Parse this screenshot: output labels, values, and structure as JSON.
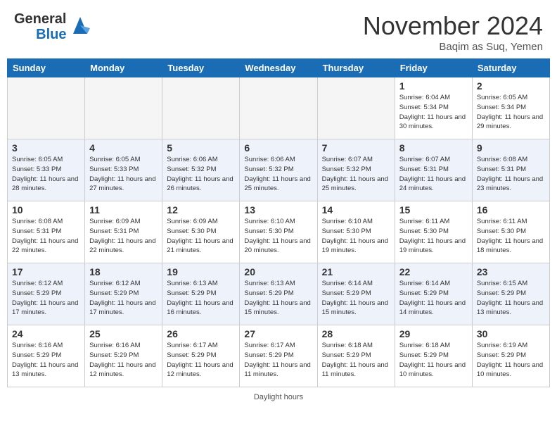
{
  "header": {
    "logo_general": "General",
    "logo_blue": "Blue",
    "month_title": "November 2024",
    "location": "Baqim as Suq, Yemen"
  },
  "days_of_week": [
    "Sunday",
    "Monday",
    "Tuesday",
    "Wednesday",
    "Thursday",
    "Friday",
    "Saturday"
  ],
  "weeks": [
    [
      {
        "day": "",
        "info": "",
        "empty": true
      },
      {
        "day": "",
        "info": "",
        "empty": true
      },
      {
        "day": "",
        "info": "",
        "empty": true
      },
      {
        "day": "",
        "info": "",
        "empty": true
      },
      {
        "day": "",
        "info": "",
        "empty": true
      },
      {
        "day": "1",
        "info": "Sunrise: 6:04 AM\nSunset: 5:34 PM\nDaylight: 11 hours and 30 minutes."
      },
      {
        "day": "2",
        "info": "Sunrise: 6:05 AM\nSunset: 5:34 PM\nDaylight: 11 hours and 29 minutes."
      }
    ],
    [
      {
        "day": "3",
        "info": "Sunrise: 6:05 AM\nSunset: 5:33 PM\nDaylight: 11 hours and 28 minutes."
      },
      {
        "day": "4",
        "info": "Sunrise: 6:05 AM\nSunset: 5:33 PM\nDaylight: 11 hours and 27 minutes."
      },
      {
        "day": "5",
        "info": "Sunrise: 6:06 AM\nSunset: 5:32 PM\nDaylight: 11 hours and 26 minutes."
      },
      {
        "day": "6",
        "info": "Sunrise: 6:06 AM\nSunset: 5:32 PM\nDaylight: 11 hours and 25 minutes."
      },
      {
        "day": "7",
        "info": "Sunrise: 6:07 AM\nSunset: 5:32 PM\nDaylight: 11 hours and 25 minutes."
      },
      {
        "day": "8",
        "info": "Sunrise: 6:07 AM\nSunset: 5:31 PM\nDaylight: 11 hours and 24 minutes."
      },
      {
        "day": "9",
        "info": "Sunrise: 6:08 AM\nSunset: 5:31 PM\nDaylight: 11 hours and 23 minutes."
      }
    ],
    [
      {
        "day": "10",
        "info": "Sunrise: 6:08 AM\nSunset: 5:31 PM\nDaylight: 11 hours and 22 minutes."
      },
      {
        "day": "11",
        "info": "Sunrise: 6:09 AM\nSunset: 5:31 PM\nDaylight: 11 hours and 22 minutes."
      },
      {
        "day": "12",
        "info": "Sunrise: 6:09 AM\nSunset: 5:30 PM\nDaylight: 11 hours and 21 minutes."
      },
      {
        "day": "13",
        "info": "Sunrise: 6:10 AM\nSunset: 5:30 PM\nDaylight: 11 hours and 20 minutes."
      },
      {
        "day": "14",
        "info": "Sunrise: 6:10 AM\nSunset: 5:30 PM\nDaylight: 11 hours and 19 minutes."
      },
      {
        "day": "15",
        "info": "Sunrise: 6:11 AM\nSunset: 5:30 PM\nDaylight: 11 hours and 19 minutes."
      },
      {
        "day": "16",
        "info": "Sunrise: 6:11 AM\nSunset: 5:30 PM\nDaylight: 11 hours and 18 minutes."
      }
    ],
    [
      {
        "day": "17",
        "info": "Sunrise: 6:12 AM\nSunset: 5:29 PM\nDaylight: 11 hours and 17 minutes."
      },
      {
        "day": "18",
        "info": "Sunrise: 6:12 AM\nSunset: 5:29 PM\nDaylight: 11 hours and 17 minutes."
      },
      {
        "day": "19",
        "info": "Sunrise: 6:13 AM\nSunset: 5:29 PM\nDaylight: 11 hours and 16 minutes."
      },
      {
        "day": "20",
        "info": "Sunrise: 6:13 AM\nSunset: 5:29 PM\nDaylight: 11 hours and 15 minutes."
      },
      {
        "day": "21",
        "info": "Sunrise: 6:14 AM\nSunset: 5:29 PM\nDaylight: 11 hours and 15 minutes."
      },
      {
        "day": "22",
        "info": "Sunrise: 6:14 AM\nSunset: 5:29 PM\nDaylight: 11 hours and 14 minutes."
      },
      {
        "day": "23",
        "info": "Sunrise: 6:15 AM\nSunset: 5:29 PM\nDaylight: 11 hours and 13 minutes."
      }
    ],
    [
      {
        "day": "24",
        "info": "Sunrise: 6:16 AM\nSunset: 5:29 PM\nDaylight: 11 hours and 13 minutes."
      },
      {
        "day": "25",
        "info": "Sunrise: 6:16 AM\nSunset: 5:29 PM\nDaylight: 11 hours and 12 minutes."
      },
      {
        "day": "26",
        "info": "Sunrise: 6:17 AM\nSunset: 5:29 PM\nDaylight: 11 hours and 12 minutes."
      },
      {
        "day": "27",
        "info": "Sunrise: 6:17 AM\nSunset: 5:29 PM\nDaylight: 11 hours and 11 minutes."
      },
      {
        "day": "28",
        "info": "Sunrise: 6:18 AM\nSunset: 5:29 PM\nDaylight: 11 hours and 11 minutes."
      },
      {
        "day": "29",
        "info": "Sunrise: 6:18 AM\nSunset: 5:29 PM\nDaylight: 11 hours and 10 minutes."
      },
      {
        "day": "30",
        "info": "Sunrise: 6:19 AM\nSunset: 5:29 PM\nDaylight: 11 hours and 10 minutes."
      }
    ]
  ],
  "footer": {
    "text": "Daylight hours"
  },
  "colors": {
    "header_bg": "#1a6db5",
    "alt_row": "#eef2fa"
  }
}
